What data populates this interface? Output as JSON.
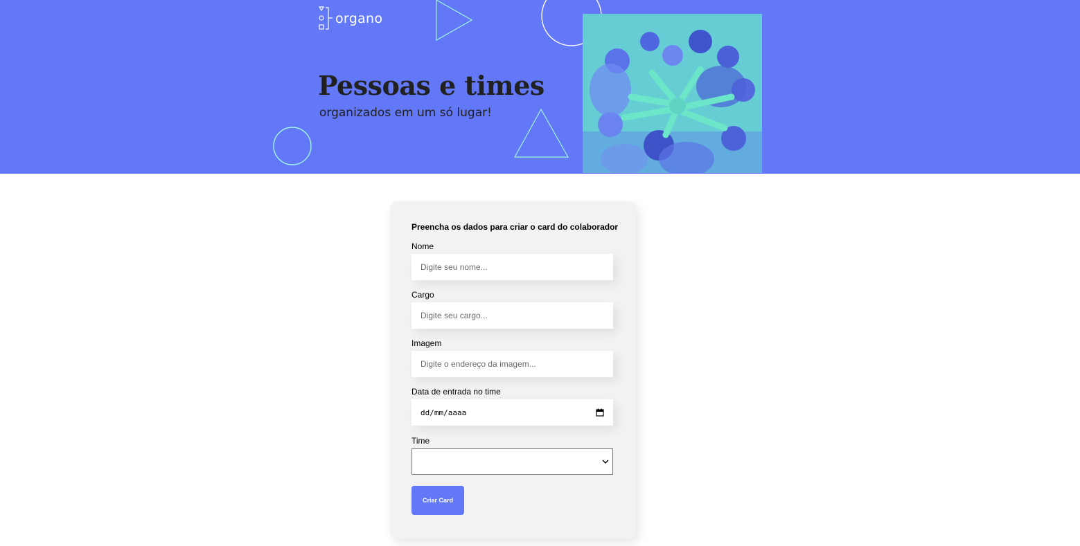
{
  "banner": {
    "logo_text": "organo",
    "headline": "Pessoas e times",
    "subheadline": "organizados em um só lugar!",
    "photo_icon": "team-hands-photo"
  },
  "form": {
    "title": "Preencha os dados para criar o card do colaborador",
    "fields": [
      {
        "label": "Nome",
        "placeholder": "Digite seu nome..."
      },
      {
        "label": "Cargo",
        "placeholder": "Digite seu cargo..."
      },
      {
        "label": "Imagem",
        "placeholder": "Digite o endereço da imagem..."
      }
    ],
    "date_field": {
      "label": "Data de entrada no time",
      "value": "dd/mm/aaaa",
      "icon": "calendar-icon"
    },
    "team_field": {
      "label": "Time",
      "value": "",
      "icon": "chevron-down-icon"
    },
    "submit_label": "Criar Card"
  },
  "colors": {
    "brand": "#6278F7",
    "accent_outline": "#A2F5DF",
    "photo_tint": "#6CE6C9",
    "card_background": "#F2F2F2"
  }
}
